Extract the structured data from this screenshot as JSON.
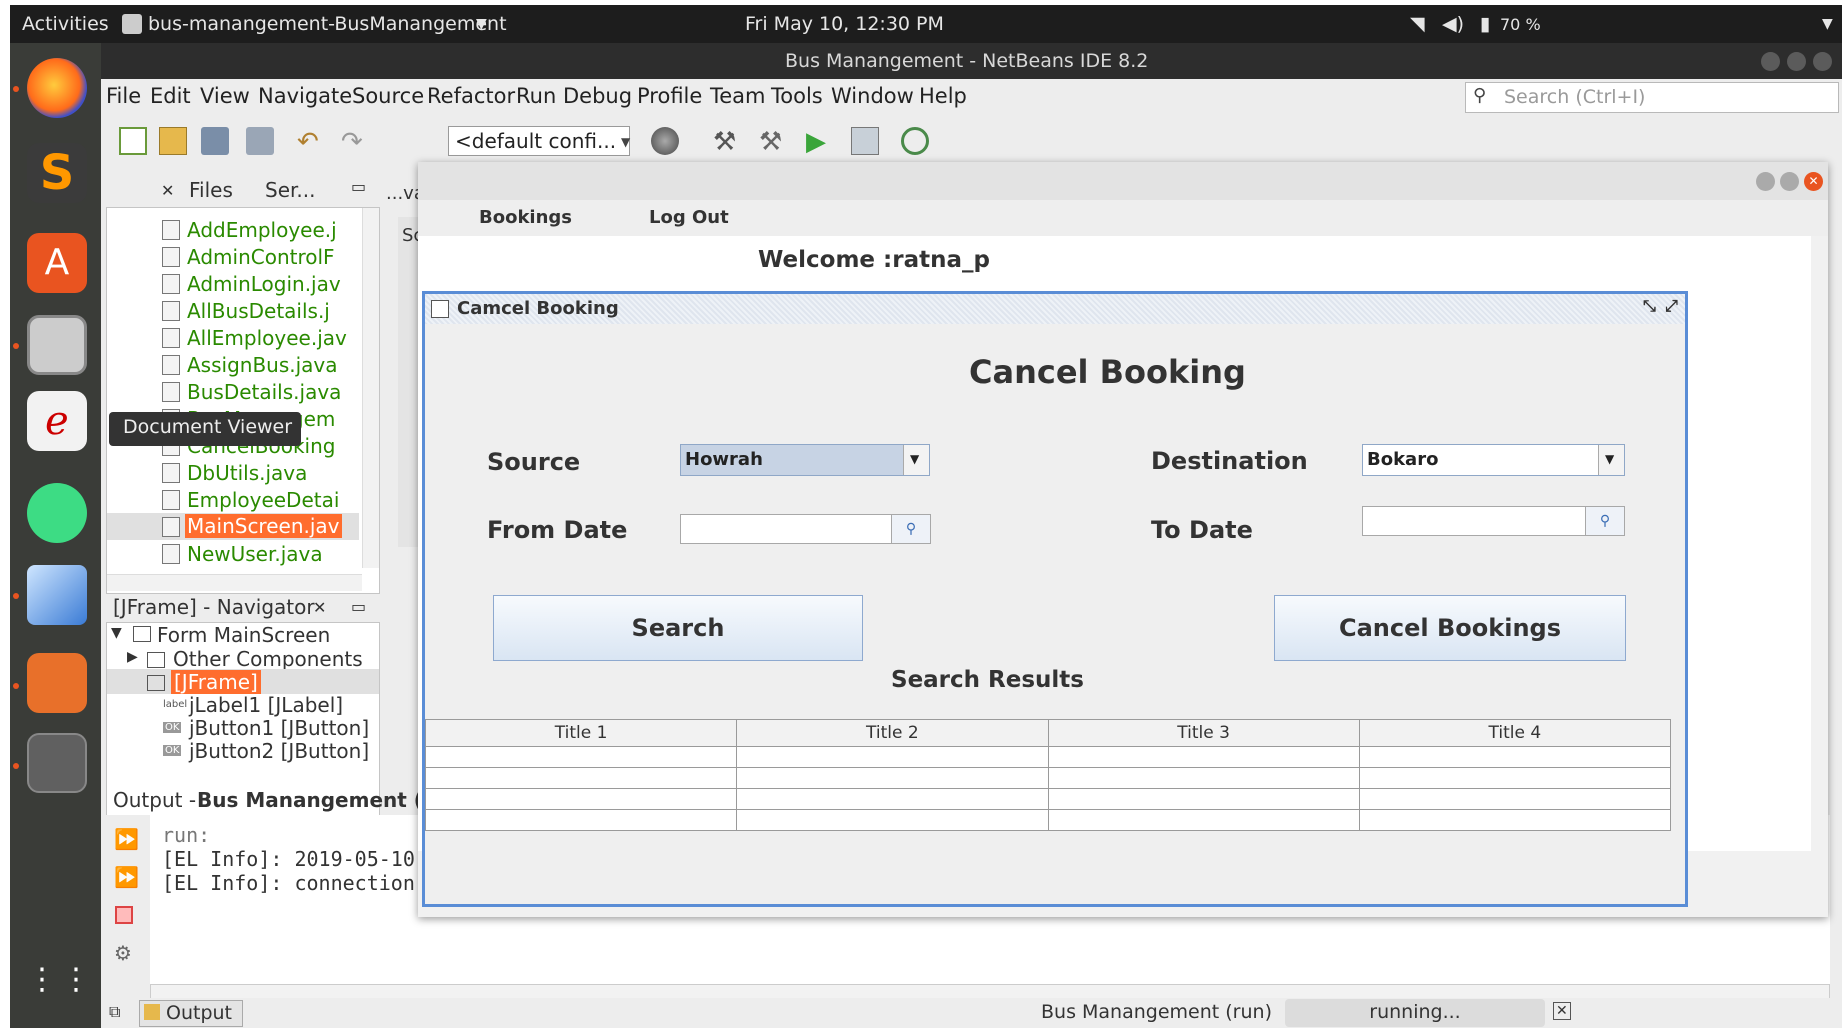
{
  "topbar": {
    "activities": "Activities",
    "app_menu": "bus-manangement-BusManangement",
    "clock": "Fri May 10, 12:30 PM",
    "battery": "70 %"
  },
  "ide": {
    "window_title": "Bus Manangement - NetBeans IDE 8.2",
    "menu": [
      "File",
      "Edit",
      "View",
      "Navigate",
      "Source",
      "Refactor",
      "Run",
      "Debug",
      "Profile",
      "Team",
      "Tools",
      "Window",
      "Help"
    ],
    "search_placeholder": "Search (Ctrl+I)",
    "config": "<default confi...",
    "project_tabs": [
      "Files",
      "Ser..."
    ],
    "editor_tab": "...va",
    "editor_sub": "Sc",
    "files": [
      "AddEmployee.j",
      "AdminControlF",
      "AdminLogin.jav",
      "AllBusDetails.j",
      "AllEmployee.jav",
      "AssignBus.java",
      "BusDetails.java",
      "BusManangem",
      "CancelBooking",
      "DbUtils.java",
      "EmployeeDetai",
      "MainScreen.jav",
      "NewUser.java"
    ],
    "tooltip": "Document Viewer",
    "navigator_tab": "[JFrame] - Navigator",
    "navigator": {
      "form": "Form MainScreen",
      "other": "Other Components",
      "jframe": "[JFrame]",
      "label1": "jLabel1 [JLabel]",
      "button1": "jButton1 [JButton]",
      "button2": "jButton2 [JButton]"
    },
    "output_tab_prefix": "Output -",
    "output_tab_bold": "Bus Manangement (ru",
    "output_lines": [
      "run:",
      "[EL Info]: 2019-05-10",
      "[EL Info]: connection"
    ],
    "status_output": "Output",
    "status_run": "Bus Manangement (run)",
    "status_running": "running..."
  },
  "app": {
    "menu_bookings": "Bookings",
    "menu_logout": "Log Out",
    "welcome": "Welcome :ratna_p",
    "internal_title": "Camcel Booking",
    "heading": "Cancel Booking",
    "source_label": "Source",
    "source_value": "Howrah",
    "destination_label": "Destination",
    "destination_value": "Bokaro",
    "from_label": "From Date",
    "to_label": "To Date",
    "search_btn": "Search",
    "cancel_btn": "Cancel Bookings",
    "results_title": "Search Results",
    "columns": [
      "Title 1",
      "Title 2",
      "Title 3",
      "Title 4"
    ]
  },
  "colors": {
    "accent": "#5a8dd6",
    "selected": "#ff6d2e",
    "file_green": "#2a8a00",
    "ubuntu_orange": "#e95420"
  }
}
